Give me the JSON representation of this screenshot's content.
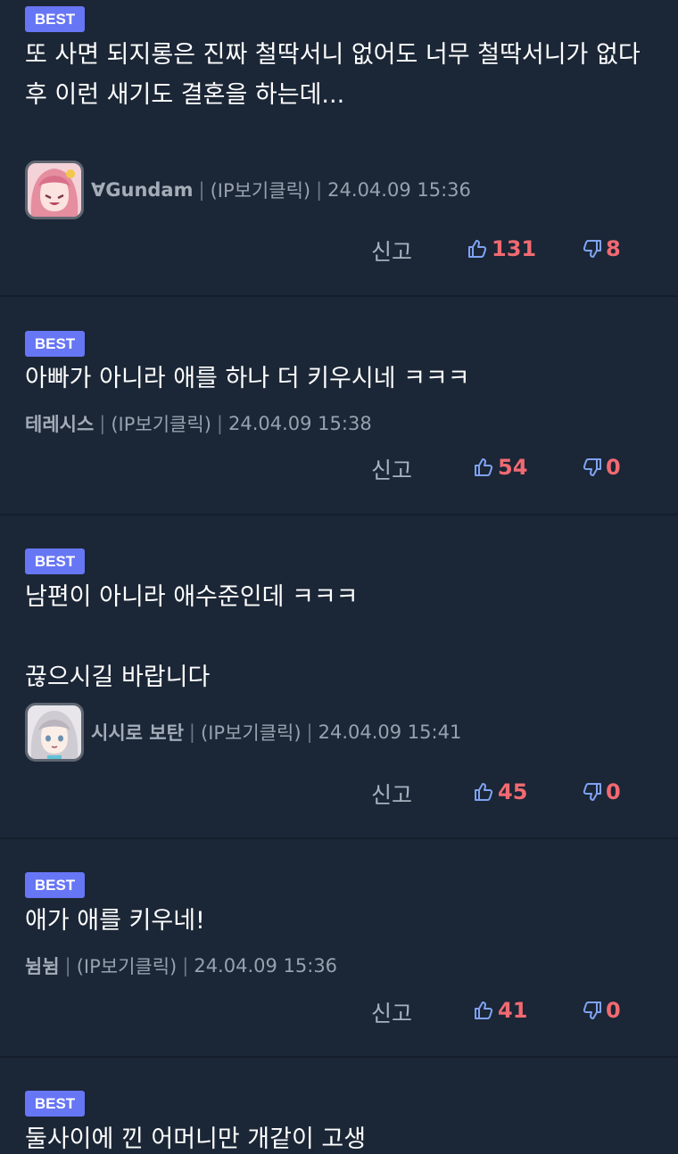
{
  "ui": {
    "report_label": "신고",
    "sep": "|",
    "ip_label": "(IP보기클릭)"
  },
  "comments": [
    {
      "badge": "BEST",
      "text": "또 사면 되지롱은 진짜 철딱서니 없어도 너무 철딱서니가 없다\n후 이런 새기도 결혼을 하는데...",
      "author": "∀Gundam",
      "date": "24.04.09 15:36",
      "likes": "131",
      "dislikes": "8",
      "avatar": "anime-girl-pink-hair"
    },
    {
      "badge": "BEST",
      "text": "아빠가 아니라 애를 하나 더 키우시네 ㅋㅋㅋ",
      "author": "테레시스",
      "date": "24.04.09 15:38",
      "likes": "54",
      "dislikes": "0"
    },
    {
      "badge": "BEST",
      "text": "남편이 아니라 애수준인데 ㅋㅋㅋ\n\n끊으시길 바랍니다",
      "author": "시시로 보탄",
      "date": "24.04.09 15:41",
      "likes": "45",
      "dislikes": "0",
      "avatar": "anime-girl-silver-hair"
    },
    {
      "badge": "BEST",
      "text": "애가 애를 키우네!",
      "author": "뉨뉨",
      "date": "24.04.09 15:36",
      "likes": "41",
      "dislikes": "0"
    },
    {
      "badge": "BEST",
      "text": "둘사이에 낀 어머니만 개같이 고생"
    }
  ],
  "colors": {
    "background": "#1b2636",
    "badge": "#6776f4",
    "like_icon": "#7fa3f2",
    "count": "#f16a72"
  }
}
